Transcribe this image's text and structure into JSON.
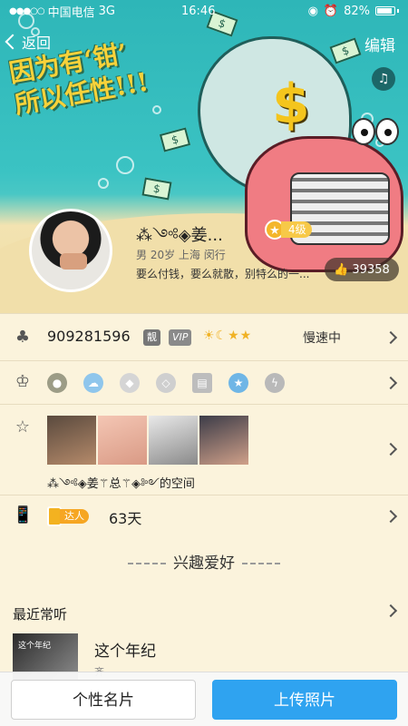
{
  "status_bar": {
    "carrier": "中国电信",
    "network": "3G",
    "time": "16:46",
    "battery": "82%",
    "battery_level": 0.82
  },
  "nav": {
    "back_label": "返回",
    "edit_label": "编辑"
  },
  "cover": {
    "title_line1": "因为有‘钳’",
    "title_line2": "所以任性!!!",
    "money_sign": "$"
  },
  "profile": {
    "nickname": "⁂༺◈姜...",
    "level": "4级",
    "info": "男  20岁  上海 闵行",
    "signature": "要么付钱，要么就散，别特么的一...",
    "likes": "39358"
  },
  "rows": {
    "qq": {
      "number": "909281596",
      "pretty_tag": "靓",
      "vip_tag": "VIP",
      "level_icons": "☀☾★★",
      "speed": "慢速中"
    },
    "badges": {
      "icons": [
        "crown-icon",
        "game-icon",
        "cloud-icon",
        "diamond-icon",
        "diamond-outline-icon",
        "book-icon",
        "star-icon",
        "flash-icon"
      ]
    },
    "space": {
      "label": "⁂༺◈姜⚚总⚚◈༻的空间"
    },
    "online": {
      "tag": "达人",
      "days": "63天"
    }
  },
  "interests": {
    "title": "兴趣爱好"
  },
  "recent": {
    "title": "最近常听",
    "song": "这个年纪",
    "artist": "齐",
    "album_text": "这个年纪"
  },
  "bottom": {
    "card_button": "个性名片",
    "upload_button": "上传照片"
  },
  "colors": {
    "accent_blue": "#2fa3f0",
    "gold": "#f4b62b",
    "page_bg": "#fbf3dc"
  }
}
